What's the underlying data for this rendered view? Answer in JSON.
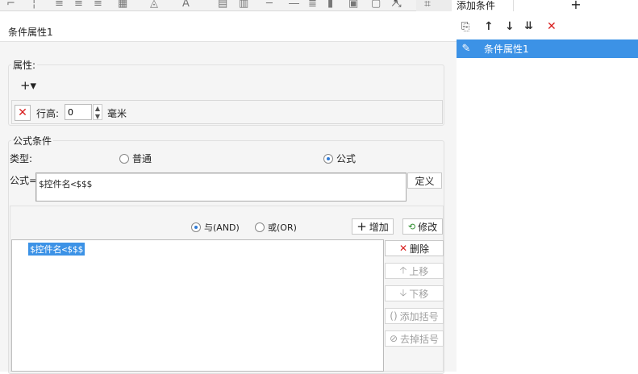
{
  "panel": {
    "title": "条件属性1"
  },
  "properties": {
    "label": "属性:",
    "add_button": "+▾",
    "row_height": {
      "label": "行高:",
      "value": "0",
      "unit": "毫米"
    }
  },
  "formula_condition": {
    "group_label": "公式条件",
    "type_label": "类型:",
    "radio_normal": "普通",
    "radio_formula": "公式",
    "formula_label": "公式=",
    "formula_value": "$控件名<$$$",
    "define_button": "定义"
  },
  "logic": {
    "and_label": "与(AND)",
    "or_label": "或(OR)",
    "add_button": "增加",
    "modify_button": "修改"
  },
  "conditions_list": {
    "items": [
      "$控件名<$$$"
    ]
  },
  "side_actions": {
    "delete": "删除",
    "move_up": "上移",
    "move_down": "下移",
    "add_bracket": "添加括号",
    "remove_bracket": "去掉括号"
  },
  "right_panel": {
    "tab_add_condition": "添加条件",
    "plus": "+",
    "items": [
      "条件属性1"
    ]
  }
}
